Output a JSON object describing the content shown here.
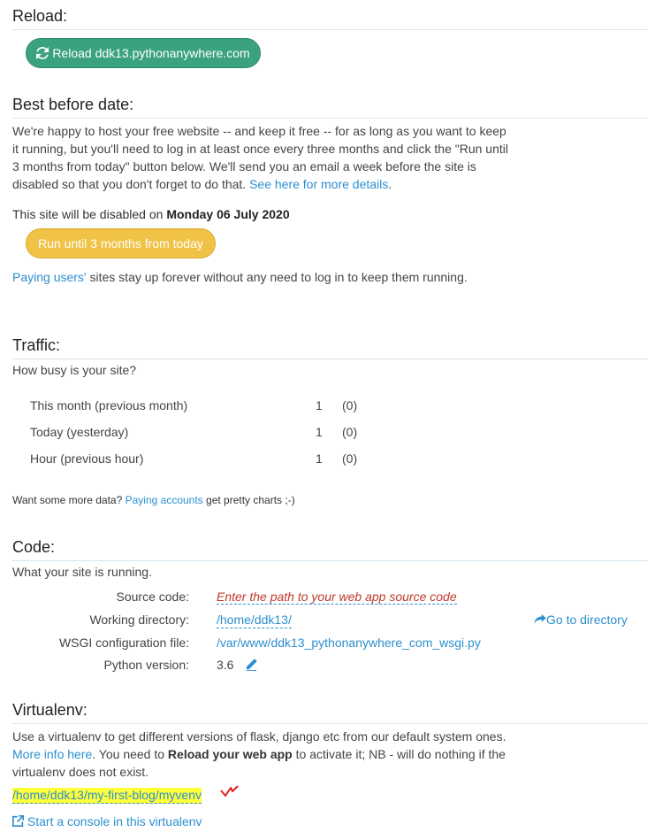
{
  "reload": {
    "heading": "Reload:",
    "button_label": "Reload ddk13.pythonanywhere.com"
  },
  "best_before": {
    "heading": "Best before date:",
    "para_main": "We're happy to host your free website -- and keep it free -- for as long as you want to keep it running, but you'll need to log in at least once every three months and click the \"Run until 3 months from today\" button below. We'll send you an email a week before the site is disabled so that you don't forget to do that. ",
    "para_link": "See here for more details",
    "para_end": ".",
    "disabled_prefix": "This site will be disabled on ",
    "disabled_date": "Monday 06 July 2020",
    "run_button_label": "Run until 3 months from today",
    "paying_link": "Paying users'",
    "paying_rest": " sites stay up forever without any need to log in to keep them running."
  },
  "traffic": {
    "heading": "Traffic:",
    "subtitle": "How busy is your site?",
    "rows": [
      {
        "label": "This month (previous month)",
        "value": "1",
        "previous": "(0)"
      },
      {
        "label": "Today (yesterday)",
        "value": "1",
        "previous": "(0)"
      },
      {
        "label": "Hour (previous hour)",
        "value": "1",
        "previous": "(0)"
      }
    ],
    "more_prefix": "Want some more data? ",
    "more_link": "Paying accounts",
    "more_suffix": " get pretty charts ;-)"
  },
  "code": {
    "heading": "Code:",
    "subtitle": "What your site is running.",
    "source_label": "Source code:",
    "source_placeholder": "Enter the path to your web app source code",
    "workdir_label": "Working directory:",
    "workdir_value": "/home/ddk13/",
    "goto_label": "Go to directory",
    "wsgi_label": "WSGI configuration file:",
    "wsgi_value": "/var/www/ddk13_pythonanywhere_com_wsgi.py",
    "python_label": "Python version:",
    "python_value": "3.6"
  },
  "virtualenv": {
    "heading": "Virtualenv:",
    "para_1": "Use a virtualenv to get different versions of flask, django etc from our default system ones. ",
    "para_link": "More info here",
    "para_2": ". You need to ",
    "para_bold": "Reload your web app",
    "para_3": " to activate it; NB - will do nothing if the virtualenv does not exist.",
    "path": "/home/ddk13/my-first-blog/myvenv",
    "console_link": "Start a console in this virtualenv"
  },
  "colors": {
    "reload_button": "#3aa27e",
    "run_button": "#f0c246",
    "link": "#2c8fd0",
    "highlight": "#ffff3a",
    "annotation": "#e02020"
  }
}
